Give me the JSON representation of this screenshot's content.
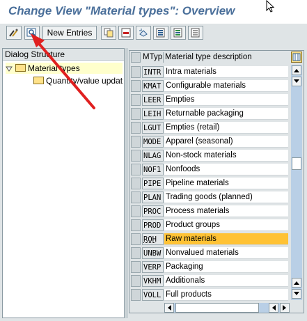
{
  "title": "Change View \"Material types\": Overview",
  "toolbar": {
    "new_entries_label": "New Entries",
    "icons": [
      "display-change-icon",
      "details-icon",
      "copy-as-icon",
      "delete-icon",
      "undo-change-icon",
      "select-all-icon",
      "select-block-icon",
      "deselect-all-icon"
    ]
  },
  "dialog_structure": {
    "header": "Dialog Structure",
    "items": [
      {
        "label": "Material types",
        "selected": true
      },
      {
        "label": "Quantity/value updati",
        "selected": false
      }
    ]
  },
  "table": {
    "columns": [
      "MTyp",
      "Material type description"
    ],
    "rows": [
      {
        "code": "INTR",
        "desc": "Intra materials"
      },
      {
        "code": "KMAT",
        "desc": "Configurable materials"
      },
      {
        "code": "LEER",
        "desc": "Empties"
      },
      {
        "code": "LEIH",
        "desc": "Returnable packaging"
      },
      {
        "code": "LGUT",
        "desc": "Empties (retail)"
      },
      {
        "code": "MODE",
        "desc": "Apparel (seasonal)"
      },
      {
        "code": "NLAG",
        "desc": "Non-stock materials"
      },
      {
        "code": "NOF1",
        "desc": "Nonfoods"
      },
      {
        "code": "PIPE",
        "desc": "Pipeline materials"
      },
      {
        "code": "PLAN",
        "desc": "Trading goods (planned)"
      },
      {
        "code": "PROC",
        "desc": "Process materials"
      },
      {
        "code": "PROD",
        "desc": "Product groups"
      },
      {
        "code": "ROH",
        "desc": "Raw materials",
        "highlight": true
      },
      {
        "code": "UNBW",
        "desc": "Nonvalued materials"
      },
      {
        "code": "VERP",
        "desc": "Packaging"
      },
      {
        "code": "VKHM",
        "desc": "Additionals"
      },
      {
        "code": "VOLL",
        "desc": "Full products"
      }
    ]
  },
  "colors": {
    "title": "#4a6f9a",
    "highlight": "#ffc235",
    "scrollbar": "#b9cfe6",
    "annotation_arrow": "#e02020"
  }
}
